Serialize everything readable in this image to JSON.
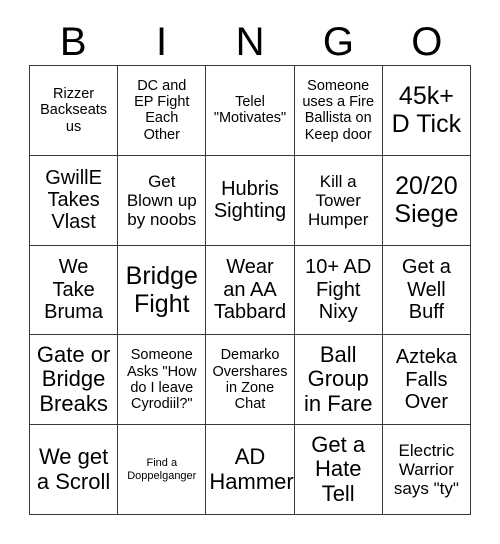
{
  "card": {
    "header_letters": [
      "B",
      "I",
      "N",
      "G",
      "O"
    ],
    "rows": 5,
    "columns": 5,
    "colors": {
      "background": "#ffffff",
      "cell_background": "#ffffff",
      "border": "#3a3a3a",
      "text": "#000000"
    },
    "cells": [
      {
        "text": "Rizzer\nBackseats\nus",
        "size": "sm"
      },
      {
        "text": "DC and\nEP Fight\nEach\nOther",
        "size": "sm"
      },
      {
        "text": "Telel\n\"Motivates\"",
        "size": "sm"
      },
      {
        "text": "Someone\nuses a Fire\nBallista on\nKeep door",
        "size": "sm"
      },
      {
        "text": "45k+\nD Tick",
        "size": "xxl"
      },
      {
        "text": "GwillE\nTakes\nVlast",
        "size": "lg"
      },
      {
        "text": "Get\nBlown up\nby noobs",
        "size": "md"
      },
      {
        "text": "Hubris\nSighting",
        "size": "lg"
      },
      {
        "text": "Kill a\nTower\nHumper",
        "size": "md"
      },
      {
        "text": "20/20\nSiege",
        "size": "xxl"
      },
      {
        "text": "We\nTake\nBruma",
        "size": "lg"
      },
      {
        "text": "Bridge\nFight",
        "size": "xxl"
      },
      {
        "text": "Wear\nan AA\nTabbard",
        "size": "lg"
      },
      {
        "text": "10+ AD\nFight\nNixy",
        "size": "lg"
      },
      {
        "text": "Get a\nWell\nBuff",
        "size": "lg"
      },
      {
        "text": "Gate or\nBridge\nBreaks",
        "size": "xl"
      },
      {
        "text": "Someone\nAsks \"How\ndo I leave\nCyrodiil?\"",
        "size": "sm"
      },
      {
        "text": "Demarko\nOvershares\nin Zone\nChat",
        "size": "sm"
      },
      {
        "text": "Ball\nGroup\nin Fare",
        "size": "xl"
      },
      {
        "text": "Azteka\nFalls\nOver",
        "size": "lg"
      },
      {
        "text": "We get\na Scroll",
        "size": "xl"
      },
      {
        "text": "Find a\nDoppelganger",
        "size": "xs"
      },
      {
        "text": "AD\nHammer",
        "size": "xl"
      },
      {
        "text": "Get a\nHate\nTell",
        "size": "xl"
      },
      {
        "text": "Electric\nWarrior\nsays \"ty\"",
        "size": "md"
      }
    ]
  }
}
